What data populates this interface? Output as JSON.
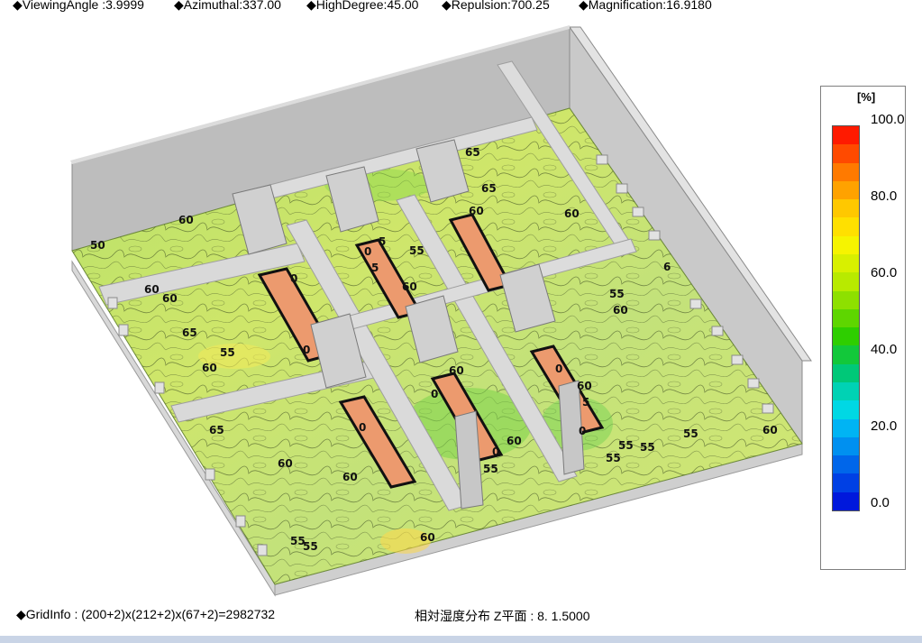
{
  "params": [
    {
      "id": "viewing-angle",
      "text": "◆ViewingAngle :3.9999"
    },
    {
      "id": "azimuthal",
      "text": "◆Azimuthal:337.00"
    },
    {
      "id": "high-degree",
      "text": "◆HighDegree:45.00"
    },
    {
      "id": "repulsion",
      "text": "◆Repulsion:700.25"
    },
    {
      "id": "magnification",
      "text": "◆Magnification:16.9180"
    }
  ],
  "legend": {
    "unit": "[%]",
    "ticks": [
      "100.0",
      "80.0",
      "60.0",
      "40.0",
      "20.0",
      "0.0"
    ],
    "colors": [
      "#ff1a00",
      "#ff4a00",
      "#ff7a00",
      "#ffa200",
      "#ffc800",
      "#ffe000",
      "#f6f400",
      "#d8f000",
      "#b8ea00",
      "#8ee000",
      "#5ed600",
      "#2ece00",
      "#12c83a",
      "#00c878",
      "#00d2b4",
      "#00d8e4",
      "#00b4f4",
      "#0090f0",
      "#0066ea",
      "#0040e4",
      "#0018dc"
    ]
  },
  "contour_labels": [
    "50",
    "60",
    "60",
    "65",
    "55",
    "60",
    "65",
    "60",
    "60",
    "55",
    "65",
    "60",
    "0",
    "5",
    "60",
    "55",
    "0",
    "5",
    "60",
    "0",
    "0",
    "60",
    "60",
    "55",
    "55",
    "65",
    "55",
    "55",
    "60",
    "0",
    "60",
    "0",
    "60",
    "0",
    "5",
    "55",
    "60",
    "55",
    "55",
    "60",
    "0",
    "6"
  ],
  "status": {
    "grid_info": "◆GridInfo : (200+2)x(212+2)x(67+2)=2982732",
    "plane_info": "相対湿度分布 Z平面 : 8. 1.5000"
  }
}
